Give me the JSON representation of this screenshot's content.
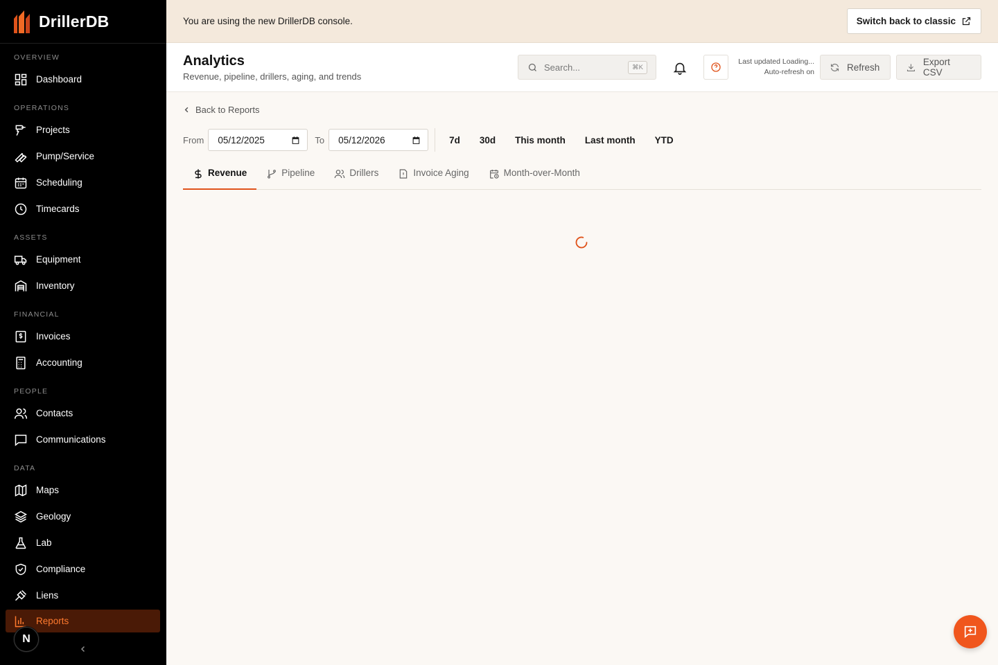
{
  "brand": {
    "name": "DrillerDB"
  },
  "sidebar": {
    "sections": [
      {
        "label": "OVERVIEW"
      },
      {
        "label": "OPERATIONS"
      },
      {
        "label": "ASSETS"
      },
      {
        "label": "FINANCIAL"
      },
      {
        "label": "PEOPLE"
      },
      {
        "label": "DATA"
      }
    ],
    "items": [
      {
        "label": "Dashboard",
        "icon": "dashboard-icon"
      },
      {
        "label": "Projects",
        "icon": "drill-icon"
      },
      {
        "label": "Pump/Service",
        "icon": "wrench-icon"
      },
      {
        "label": "Scheduling",
        "icon": "calendar-icon"
      },
      {
        "label": "Timecards",
        "icon": "clock-icon"
      },
      {
        "label": "Equipment",
        "icon": "truck-icon"
      },
      {
        "label": "Inventory",
        "icon": "warehouse-icon"
      },
      {
        "label": "Invoices",
        "icon": "invoice-icon"
      },
      {
        "label": "Accounting",
        "icon": "calculator-icon"
      },
      {
        "label": "Contacts",
        "icon": "users-icon"
      },
      {
        "label": "Communications",
        "icon": "message-icon"
      },
      {
        "label": "Maps",
        "icon": "map-icon"
      },
      {
        "label": "Geology",
        "icon": "layers-icon"
      },
      {
        "label": "Lab",
        "icon": "flask-icon"
      },
      {
        "label": "Compliance",
        "icon": "shield-check-icon"
      },
      {
        "label": "Liens",
        "icon": "gavel-icon"
      },
      {
        "label": "Reports",
        "icon": "bar-chart-icon",
        "active": true
      }
    ],
    "avatar_initial": "N"
  },
  "banner": {
    "text": "You are using the new DrillerDB console.",
    "button_label": "Switch back to classic"
  },
  "header": {
    "title": "Analytics",
    "subtitle": "Revenue, pipeline, drillers, aging, and trends",
    "search_placeholder": "Search...",
    "search_shortcut": "⌘K",
    "last_updated": "Last updated Loading...",
    "auto_refresh": "Auto-refresh on",
    "refresh_label": "Refresh",
    "export_label": "Export CSV"
  },
  "content": {
    "back_label": "Back to Reports",
    "from_label": "From",
    "to_label": "To",
    "from_date": "05/12/2025",
    "to_date": "05/12/2026",
    "presets": [
      "7d",
      "30d",
      "This month",
      "Last month",
      "YTD"
    ],
    "tabs": [
      {
        "label": "Revenue",
        "icon": "dollar-icon",
        "active": true
      },
      {
        "label": "Pipeline",
        "icon": "git-branch-icon"
      },
      {
        "label": "Drillers",
        "icon": "users-icon"
      },
      {
        "label": "Invoice Aging",
        "icon": "file-alert-icon"
      },
      {
        "label": "Month-over-Month",
        "icon": "calendar-clock-icon"
      }
    ]
  },
  "colors": {
    "accent": "#e0531b",
    "sidebar_bg": "#000000",
    "banner_bg": "#f4e9dc",
    "page_bg": "#fbf8f4",
    "active_nav_bg": "#4a1a06"
  }
}
